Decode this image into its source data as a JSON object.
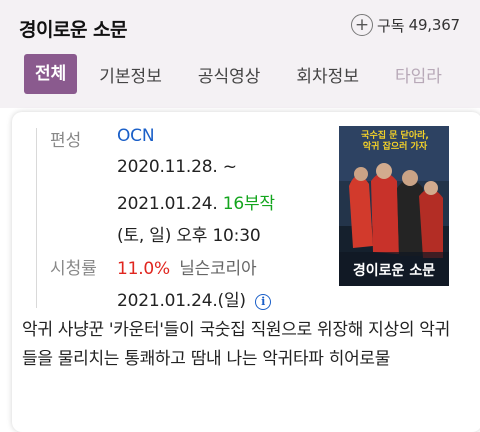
{
  "header": {
    "title": "경이로운 소문",
    "subscribe_label": "구독",
    "subscribe_count": "49,367"
  },
  "tabs": [
    "전체",
    "기본정보",
    "공식영상",
    "회차정보",
    "타임라"
  ],
  "info": {
    "channel_label": "편성",
    "channel": "OCN",
    "date_start": "2020.11.28. ~",
    "date_end": "2021.01.24.",
    "episodes": "16부작",
    "schedule": "(토, 일) 오후 10:30",
    "rating_label": "시청률",
    "rating_value": "11.0%",
    "rating_source": "닐슨코리아",
    "rating_date": "2021.01.24.(일)"
  },
  "poster": {
    "tagline_line1": "국수집 문 닫아라,",
    "tagline_line2": "악귀 잡으러 가자",
    "title_text": "경이로운 소문"
  },
  "description": "악귀 사냥꾼 '카운터'들이 국숫집 직원으로 위장해 지상의 악귀들을 물리치는 통쾌하고 땀내 나는 악귀타파 히어로물",
  "colors": {
    "accent_purple": "#8a5a8e",
    "link_blue": "#1a5fc8",
    "episode_green": "#14a51e",
    "rating_red": "#e0261f"
  }
}
